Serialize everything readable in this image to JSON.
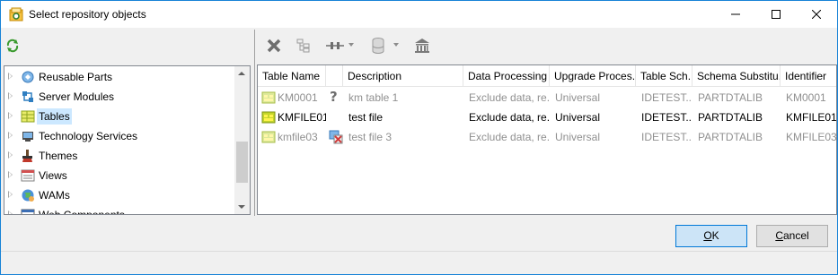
{
  "window": {
    "title": "Select repository objects",
    "accent_color": "#1883d7"
  },
  "tree": {
    "items": [
      {
        "label": "Reusable Parts",
        "icon": "reusable-parts-icon"
      },
      {
        "label": "Server Modules",
        "icon": "server-modules-icon"
      },
      {
        "label": "Tables",
        "icon": "tables-icon",
        "selected": true
      },
      {
        "label": "Technology Services",
        "icon": "technology-services-icon"
      },
      {
        "label": "Themes",
        "icon": "themes-icon"
      },
      {
        "label": "Views",
        "icon": "views-icon"
      },
      {
        "label": "WAMs",
        "icon": "wams-icon"
      },
      {
        "label": "Web Components",
        "icon": "web-components-icon"
      }
    ]
  },
  "toolbar": {
    "icons": [
      "delete-icon",
      "hierarchy-icon",
      "link-icon",
      "database-icon",
      "repository-icon"
    ]
  },
  "grid": {
    "columns": [
      "Table Name",
      "",
      "Description",
      "Data Processing",
      "Upgrade Proces...",
      "Table Sch...",
      "Schema Substitu...",
      "Identifier"
    ],
    "rows": [
      {
        "name": "KM0001",
        "status_icon": "question-icon",
        "description": "km table 1",
        "data_processing": "Exclude data, re...",
        "upgrade": "Universal",
        "schema": "IDETEST...",
        "schema_sub": "PARTDTALIB",
        "identifier": "KM0001",
        "dim": true
      },
      {
        "name": "KMFILE01",
        "status_icon": "",
        "description": "test file",
        "data_processing": "Exclude data, re...",
        "upgrade": "Universal",
        "schema": "IDETEST...",
        "schema_sub": "PARTDTALIB",
        "identifier": "KMFILE01",
        "dim": false
      },
      {
        "name": "kmfile03",
        "status_icon": "conflict-icon",
        "description": "test file 3",
        "data_processing": "Exclude data, re...",
        "upgrade": "Universal",
        "schema": "IDETEST...",
        "schema_sub": "PARTDTALIB",
        "identifier": "KMFILE03",
        "dim": true
      }
    ]
  },
  "buttons": {
    "ok": {
      "label": "OK",
      "accelerator": "O",
      "rest": "K"
    },
    "cancel": {
      "label": "Cancel",
      "accelerator": "C",
      "rest": "ancel"
    }
  }
}
